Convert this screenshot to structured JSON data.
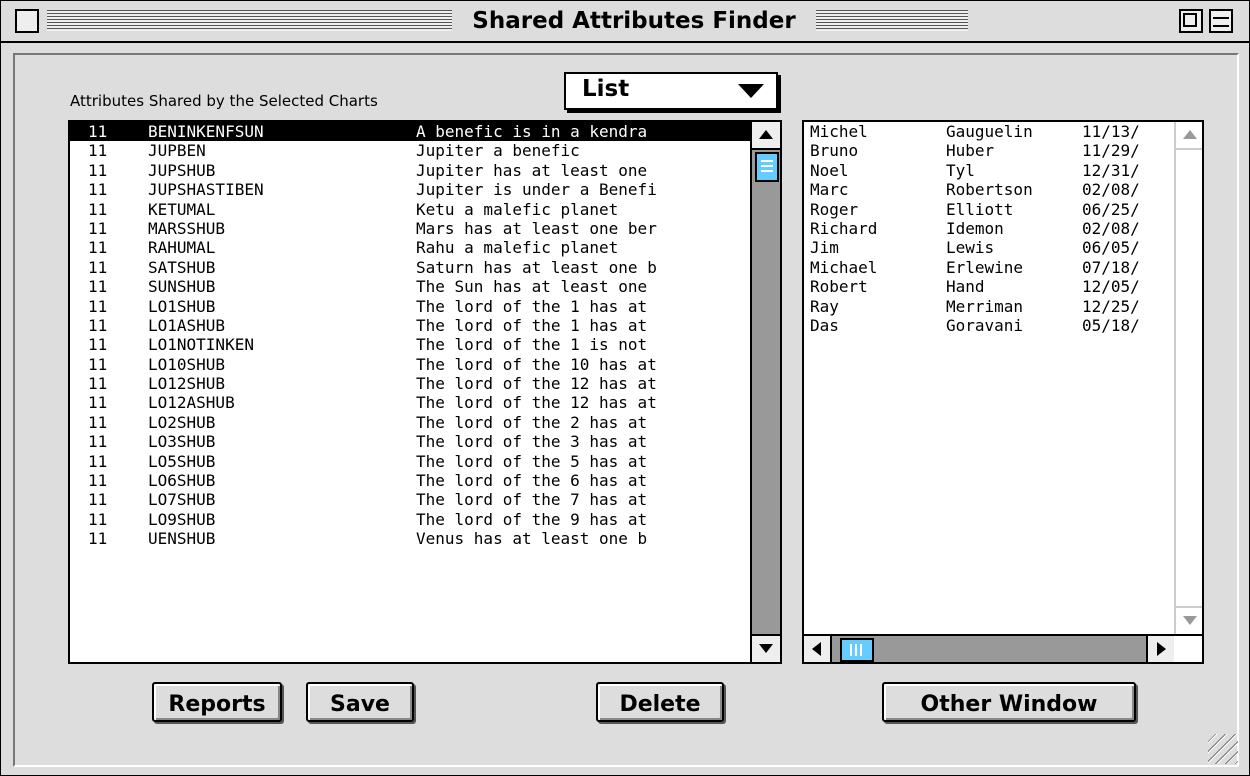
{
  "window": {
    "title": "Shared Attributes Finder"
  },
  "header": {
    "label": "Attributes Shared by the Selected Charts",
    "view_selected": "List"
  },
  "attributes": [
    {
      "count": "11",
      "code": "BENINKENFSUN",
      "desc": "A benefic is in a kendra"
    },
    {
      "count": "11",
      "code": "JUPBEN",
      "desc": "Jupiter a benefic"
    },
    {
      "count": "11",
      "code": "JUPSHUB",
      "desc": "Jupiter has at least one"
    },
    {
      "count": "11",
      "code": "JUPSHASTIBEN",
      "desc": "Jupiter is under a Benefi"
    },
    {
      "count": "11",
      "code": "KETUMAL",
      "desc": "Ketu a malefic planet"
    },
    {
      "count": "11",
      "code": "MARSSHUB",
      "desc": "Mars has at least one ber"
    },
    {
      "count": "11",
      "code": "RAHUMAL",
      "desc": "Rahu a malefic planet"
    },
    {
      "count": "11",
      "code": "SATSHUB",
      "desc": "Saturn has at least one b"
    },
    {
      "count": "11",
      "code": "SUNSHUB",
      "desc": "The Sun has at least one"
    },
    {
      "count": "11",
      "code": "LO1SHUB",
      "desc": "The lord of the 1 has at"
    },
    {
      "count": "11",
      "code": "LO1ASHUB",
      "desc": "The lord of the 1 has at"
    },
    {
      "count": "11",
      "code": "LO1NOTINKEN",
      "desc": "The lord of the 1 is not"
    },
    {
      "count": "11",
      "code": "LO10SHUB",
      "desc": "The lord of the 10 has at"
    },
    {
      "count": "11",
      "code": "LO12SHUB",
      "desc": "The lord of the 12 has at"
    },
    {
      "count": "11",
      "code": "LO12ASHUB",
      "desc": "The lord of the 12 has at"
    },
    {
      "count": "11",
      "code": "LO2SHUB",
      "desc": "The lord of the 2 has at"
    },
    {
      "count": "11",
      "code": "LO3SHUB",
      "desc": "The lord of the 3 has at"
    },
    {
      "count": "11",
      "code": "LO5SHUB",
      "desc": "The lord of the 5 has at"
    },
    {
      "count": "11",
      "code": "LO6SHUB",
      "desc": "The lord of the 6 has at"
    },
    {
      "count": "11",
      "code": "LO7SHUB",
      "desc": "The lord of the 7 has at"
    },
    {
      "count": "11",
      "code": "LO9SHUB",
      "desc": "The lord of the 9 has at"
    },
    {
      "count": "11",
      "code": "UENSHUB",
      "desc": "Venus has at least one b"
    }
  ],
  "people": [
    {
      "first": "Michel",
      "last": "Gauguelin",
      "date": "11/13/"
    },
    {
      "first": "Bruno",
      "last": "Huber",
      "date": "11/29/"
    },
    {
      "first": "Noel",
      "last": "Tyl",
      "date": "12/31/"
    },
    {
      "first": "Marc",
      "last": "Robertson",
      "date": "02/08/"
    },
    {
      "first": "Roger",
      "last": "Elliott",
      "date": "06/25/"
    },
    {
      "first": "Richard",
      "last": "Idemon",
      "date": "02/08/"
    },
    {
      "first": "Jim",
      "last": "Lewis",
      "date": "06/05/"
    },
    {
      "first": "Michael",
      "last": "Erlewine",
      "date": "07/18/"
    },
    {
      "first": "Robert",
      "last": "Hand",
      "date": "12/05/"
    },
    {
      "first": "Ray",
      "last": "Merriman",
      "date": "12/25/"
    },
    {
      "first": "Das",
      "last": "Goravani",
      "date": "05/18/"
    }
  ],
  "buttons": {
    "reports": "Reports",
    "save": "Save",
    "delete": "Delete",
    "other_window": "Other Window"
  },
  "colors": {
    "thumb": "#66ccff",
    "window_bg": "#dddddd"
  }
}
